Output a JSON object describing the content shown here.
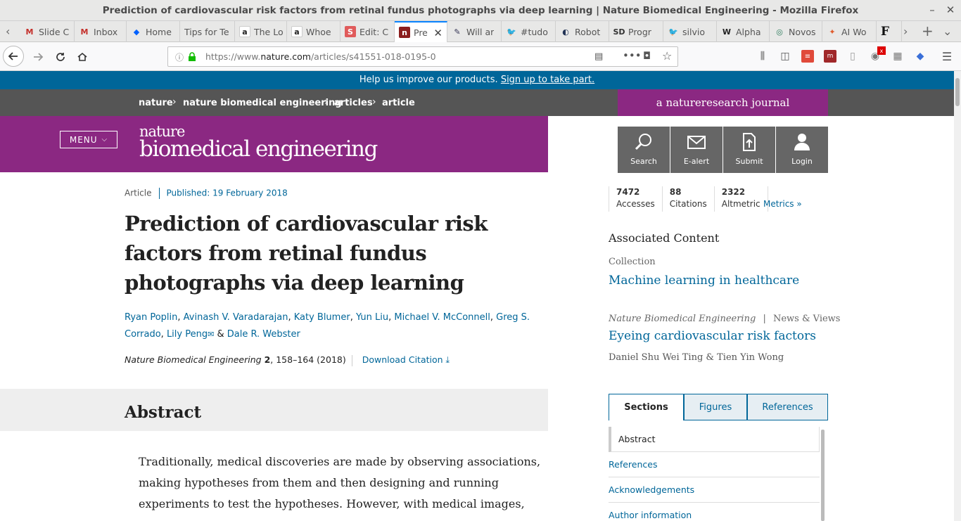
{
  "window": {
    "title": "Prediction of cardiovascular risk factors from retinal fundus photographs via deep learning | Nature Biomedical Engineering - Mozilla Firefox"
  },
  "tabs": [
    {
      "label": "Slide C",
      "icon": "gmail-icon",
      "color": "#c4302b"
    },
    {
      "label": "Inbox",
      "icon": "gmail-icon",
      "color": "#c4302b"
    },
    {
      "label": "Home",
      "icon": "dropbox-icon",
      "color": "#0061fe"
    },
    {
      "label": "Tips for Te",
      "icon": "",
      "color": ""
    },
    {
      "label": "The Lo",
      "icon": "amazon-icon",
      "color": "#222222"
    },
    {
      "label": "Whoe",
      "icon": "amazon-icon",
      "color": "#222222"
    },
    {
      "label": "Edit: C",
      "icon": "scribd-icon",
      "color": "#e05b5b"
    },
    {
      "label": "Pre",
      "icon": "nature-icon",
      "color": "#8b1e1e"
    },
    {
      "label": "Will ar",
      "icon": "blog-icon",
      "color": "#333355"
    },
    {
      "label": "#tudo",
      "icon": "twitter-icon",
      "color": "#1da1f2"
    },
    {
      "label": "Robot",
      "icon": "globe-icon",
      "color": "#223355"
    },
    {
      "label": "Progr",
      "icon": "sd-icon",
      "color": "#333333"
    },
    {
      "label": "silvio",
      "icon": "twitter-icon",
      "color": "#1da1f2"
    },
    {
      "label": "Alpha",
      "icon": "wiki-icon",
      "color": "#222222"
    },
    {
      "label": "Novos",
      "icon": "novos-icon",
      "color": "#2a7a5a"
    },
    {
      "label": "AI Wo",
      "icon": "aiwo-icon",
      "color": "#e05b2b"
    },
    {
      "label": "F",
      "icon": "",
      "color": ""
    }
  ],
  "urlbar": {
    "prefix": "https://www.",
    "domain": "nature.com",
    "path": "/articles/s41551-018-0195-0"
  },
  "banner": {
    "text": "Help us improve our products.",
    "link": "Sign up to take part."
  },
  "breadcrumb": {
    "items": [
      "nature",
      "nature biomedical engineering",
      "articles",
      "article"
    ],
    "journal_badge": "a natureresearch journal"
  },
  "masthead": {
    "menu": "MENU",
    "logo_top": "nature",
    "logo_bottom": "biomedical engineering"
  },
  "tools": [
    {
      "label": "Search",
      "icon": "search-icon"
    },
    {
      "label": "E-alert",
      "icon": "mail-icon"
    },
    {
      "label": "Submit",
      "icon": "submit-icon"
    },
    {
      "label": "Login",
      "icon": "user-icon"
    }
  ],
  "article": {
    "type": "Article",
    "published": "Published: 19 February 2018",
    "title": "Prediction of cardiovascular risk factors from retinal fundus photographs via deep learning",
    "authors": [
      "Ryan Poplin",
      "Avinash V. Varadarajan",
      "Katy Blumer",
      "Yun Liu",
      "Michael V. McConnell",
      "Greg S. Corrado",
      "Lily Peng",
      "Dale R. Webster"
    ],
    "journal": "Nature Biomedical Engineering",
    "volume": "2",
    "pages": ", 158–164 (2018)",
    "download": "Download Citation",
    "abstract_heading": "Abstract",
    "abstract_text": "Traditionally, medical discoveries are made by observing associations, making hypotheses from them and then designing and running experiments to test the hypotheses. However, with medical images,"
  },
  "metrics": [
    {
      "value": "7472",
      "label": "Accesses"
    },
    {
      "value": "88",
      "label": "Citations"
    },
    {
      "value": "2322",
      "label": "Altmetric"
    }
  ],
  "metrics_link": "Metrics",
  "associated": {
    "heading": "Associated Content",
    "collection_label": "Collection",
    "collection_link": "Machine learning in healthcare",
    "nv_journal": "Nature Biomedical Engineering",
    "nv_type": "News & Views",
    "nv_link": "Eyeing cardiovascular risk factors",
    "nv_authors": "Daniel Shu Wei Ting & Tien Yin Wong"
  },
  "section_tabs": [
    "Sections",
    "Figures",
    "References"
  ],
  "sections": [
    "Abstract",
    "References",
    "Acknowledgements",
    "Author information"
  ]
}
